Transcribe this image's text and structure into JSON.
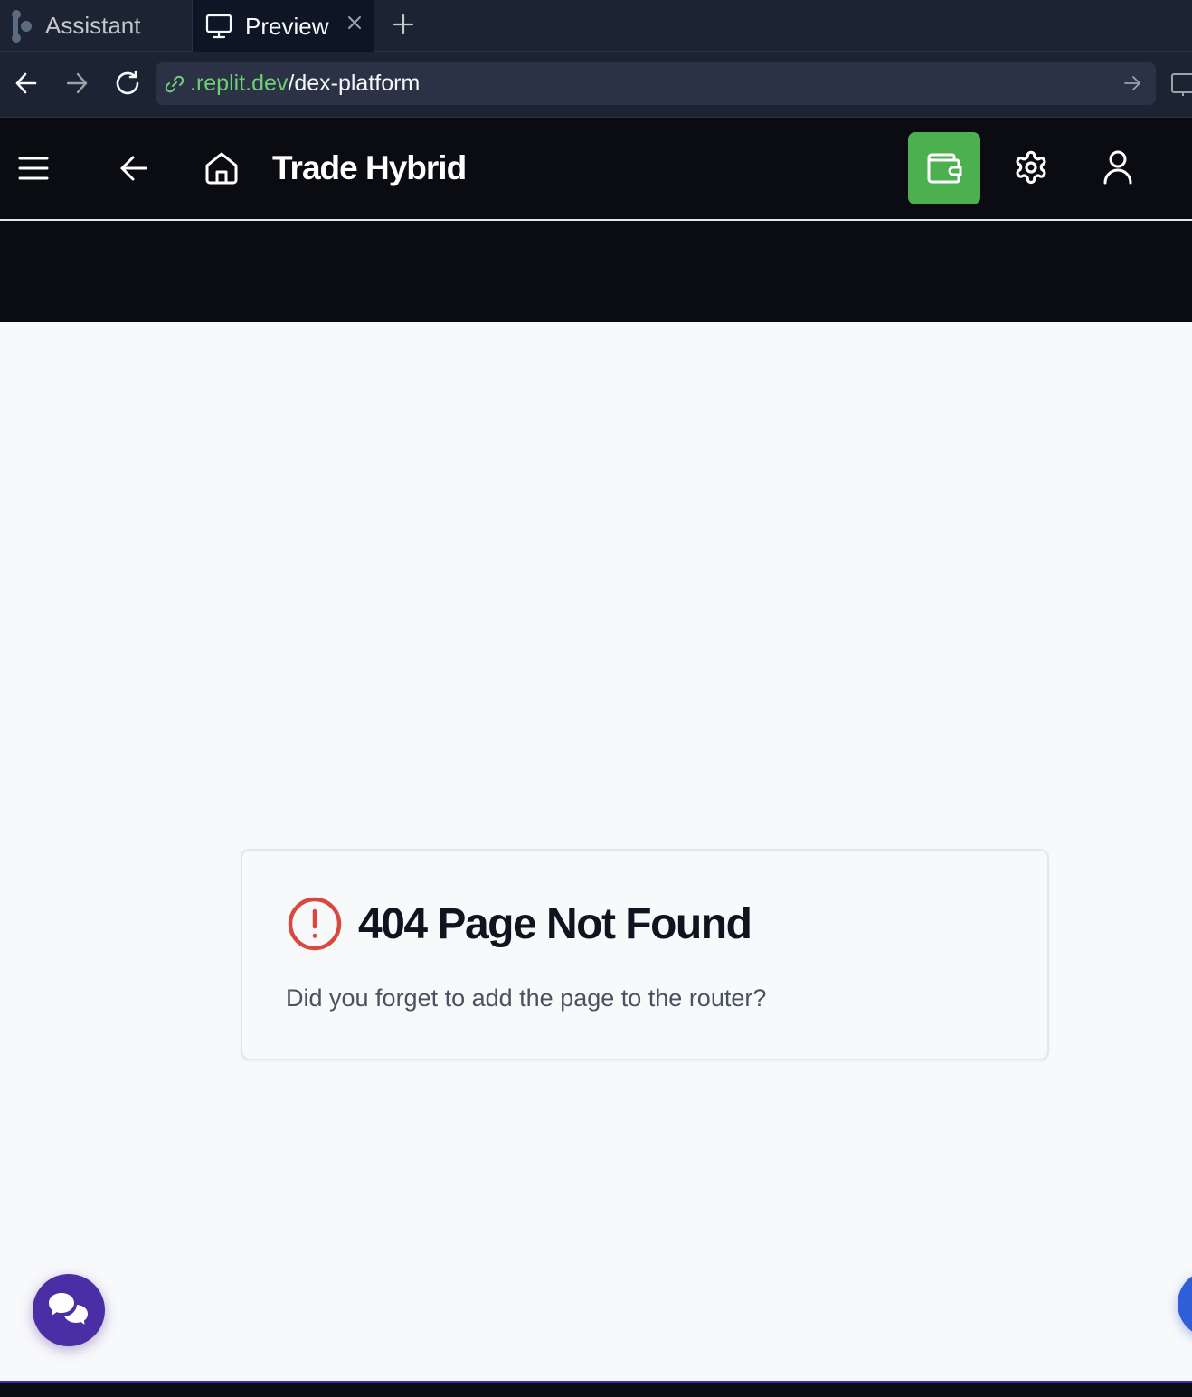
{
  "workspace": {
    "tabs": [
      {
        "label": "Assistant",
        "icon": "replit-logo-icon"
      },
      {
        "label": "Preview",
        "icon": "monitor-icon",
        "active": true
      }
    ]
  },
  "browser": {
    "url_host": ".replit.dev",
    "url_path": "/dex-platform"
  },
  "header": {
    "title": "Trade Hybrid",
    "icons": [
      "menu-icon",
      "back-arrow-icon",
      "home-icon",
      "wallet-icon",
      "gear-icon",
      "user-icon"
    ],
    "wallet_color": "#4caf50"
  },
  "not_found": {
    "title": "404 Page Not Found",
    "message": "Did you forget to add the page to the router?",
    "icon": "alert-circle-icon",
    "icon_color": "#d9473f"
  },
  "colors": {
    "chat_fab": "#4a2ea6",
    "right_fab": "#2f5fd8"
  }
}
